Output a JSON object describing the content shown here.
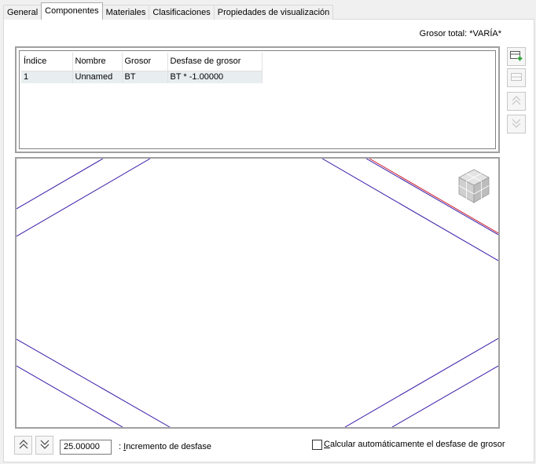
{
  "tabs": [
    {
      "label": "General",
      "active": false
    },
    {
      "label": "Componentes",
      "active": true
    },
    {
      "label": "Materiales",
      "active": false
    },
    {
      "label": "Clasificaciones",
      "active": false
    },
    {
      "label": "Propiedades de visualización",
      "active": false
    }
  ],
  "header": {
    "total_thickness": "Grosor total: *VARÍA*"
  },
  "table": {
    "columns": [
      "Índice",
      "Nombre",
      "Grosor",
      "Desfase de grosor"
    ],
    "rows": [
      {
        "index": "1",
        "name": "Unnamed",
        "thickness": "BT",
        "offset": "BT * -1.00000"
      }
    ]
  },
  "side_buttons": [
    {
      "icon": "add-component-icon",
      "enabled": true
    },
    {
      "icon": "remove-component-icon",
      "enabled": false
    },
    {
      "icon": "move-up-icon",
      "enabled": false
    },
    {
      "icon": "move-down-icon",
      "enabled": false
    }
  ],
  "preview": {
    "line_color": "#3a1aa8",
    "accent_line_color": "#cc1e2e"
  },
  "bottom": {
    "increment_value": "25.00000",
    "increment_label_prefix": ": ",
    "increment_label_mnemonic": "I",
    "increment_label_rest": "ncremento de desfase",
    "auto_calc_checked": false,
    "auto_calc_mnemonic": "C",
    "auto_calc_rest": "alcular automáticamente el desfase de grosor"
  }
}
